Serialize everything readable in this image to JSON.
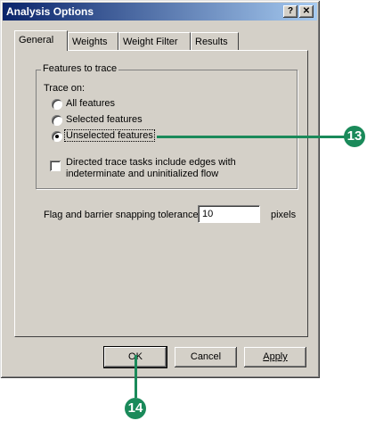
{
  "window": {
    "title": "Analysis Options",
    "help_label": "?",
    "close_label": "✕"
  },
  "tabs": [
    {
      "label": "General",
      "active": true
    },
    {
      "label": "Weights",
      "active": false
    },
    {
      "label": "Weight Filter",
      "active": false
    },
    {
      "label": "Results",
      "active": false
    }
  ],
  "features_group": {
    "legend": "Features to trace",
    "trace_on_label": "Trace on:",
    "options": [
      {
        "label": "All features",
        "selected": false
      },
      {
        "label": "Selected features",
        "selected": false
      },
      {
        "label": "Unselected features",
        "selected": true
      }
    ],
    "directed_checkbox": {
      "label_line1": "Directed trace tasks include edges with",
      "label_line2": "indeterminate and uninitialized flow",
      "checked": false
    }
  },
  "tolerance": {
    "label": "Flag and barrier snapping tolerance",
    "value": "10",
    "units": "pixels"
  },
  "buttons": {
    "ok": "OK",
    "cancel": "Cancel",
    "apply": "Apply"
  },
  "callouts": {
    "first": "13",
    "second": "14"
  },
  "colors": {
    "callout": "#1a8a5a",
    "title_start": "#0a246a",
    "title_end": "#a6caf0"
  }
}
